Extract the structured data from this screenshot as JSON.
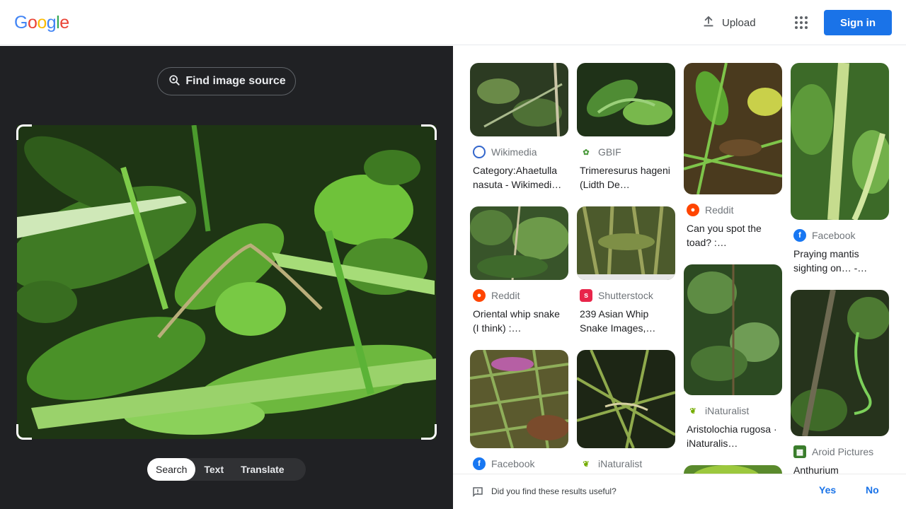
{
  "header": {
    "logo_letters": [
      "G",
      "o",
      "o",
      "g",
      "l",
      "e"
    ],
    "logo_colors": [
      "#4285f4",
      "#ea4335",
      "#fbbc05",
      "#4285f4",
      "#34a853",
      "#ea4335"
    ],
    "upload_label": "Upload",
    "upload_icon": "upload-icon",
    "apps_icon": "apps-grid-icon",
    "signin_label": "Sign in"
  },
  "left": {
    "find_source_label": "Find image source",
    "find_source_icon": "lens-search-icon",
    "modes": [
      "Search",
      "Text",
      "Translate"
    ],
    "active_mode": "Search"
  },
  "results": {
    "col1": [
      {
        "source": "Wikimedia",
        "title": "Category:Ahaetulla nasuta - Wikimedi…",
        "favicon_color": "#3366cc"
      },
      {
        "source": "Reddit",
        "title": "Oriental whip snake (I think) :…",
        "favicon_color": "#ff4500"
      },
      {
        "source": "Facebook",
        "title": "",
        "favicon_color": "#1877f2"
      }
    ],
    "col2": [
      {
        "source": "GBIF",
        "title": "Trimeresurus hageni (Lidth De…",
        "favicon_color": "#4c9a3d"
      },
      {
        "source": "Shutterstock",
        "title": "239 Asian Whip Snake Images,…",
        "favicon_color": "#e8254a"
      },
      {
        "source": "iNaturalist",
        "title": "",
        "favicon_color": "#74ac00"
      }
    ],
    "col3": [
      {
        "source": "Reddit",
        "title": "Can you spot the toad? :…",
        "favicon_color": "#ff4500"
      },
      {
        "source": "iNaturalist",
        "title": "Aristolochia rugosa · iNaturalis…",
        "favicon_color": "#74ac00"
      }
    ],
    "col4": [
      {
        "source": "Facebook",
        "title": "Praying mantis sighting on… -…",
        "favicon_color": "#1877f2"
      },
      {
        "source": "Aroid Pictures",
        "title": "Anthurium",
        "favicon_color": "#3a7d2c"
      }
    ]
  },
  "feedback": {
    "question": "Did you find these results useful?",
    "yes_label": "Yes",
    "no_label": "No"
  },
  "colors": {
    "accent": "#1a73e8",
    "dark_panel": "#202124",
    "leaf_green": "#6bb83a"
  }
}
